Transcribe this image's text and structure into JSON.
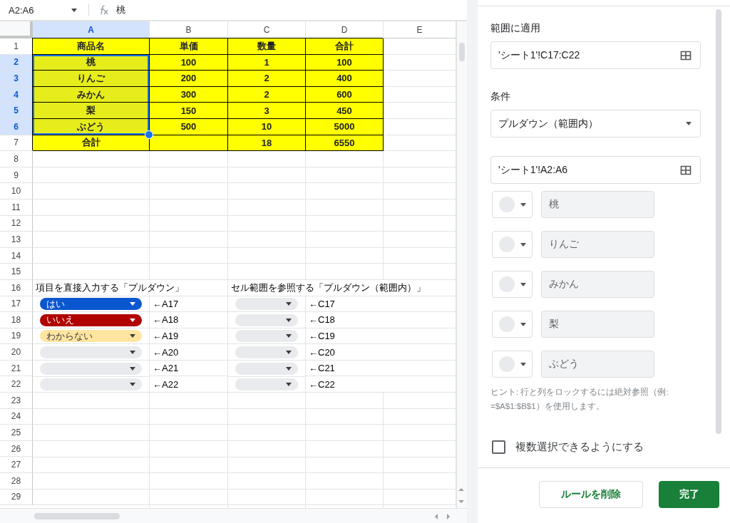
{
  "formula_bar": {
    "name_box": "A2:A6",
    "formula": "桃"
  },
  "sheet": {
    "columns": [
      {
        "label": "A",
        "selected": true
      },
      {
        "label": "B",
        "selected": false
      },
      {
        "label": "C",
        "selected": false
      },
      {
        "label": "D",
        "selected": false
      },
      {
        "label": "E",
        "selected": false
      }
    ],
    "rows": [
      {
        "number": "1",
        "selected": false,
        "cells": [
          {
            "kind": "filled",
            "text": "商品名"
          },
          {
            "kind": "filled",
            "text": "単価"
          },
          {
            "kind": "filled",
            "text": "数量"
          },
          {
            "kind": "filled",
            "text": "合計"
          }
        ]
      },
      {
        "number": "2",
        "selected": true,
        "cells": [
          {
            "kind": "filled",
            "text": "桃"
          },
          {
            "kind": "filled",
            "text": "100"
          },
          {
            "kind": "filled",
            "text": "1"
          },
          {
            "kind": "filled",
            "text": "100"
          }
        ]
      },
      {
        "number": "3",
        "selected": true,
        "cells": [
          {
            "kind": "filled",
            "text": "りんご"
          },
          {
            "kind": "filled",
            "text": "200"
          },
          {
            "kind": "filled",
            "text": "2"
          },
          {
            "kind": "filled",
            "text": "400"
          }
        ]
      },
      {
        "number": "4",
        "selected": true,
        "cells": [
          {
            "kind": "filled",
            "text": "みかん"
          },
          {
            "kind": "filled",
            "text": "300"
          },
          {
            "kind": "filled",
            "text": "2"
          },
          {
            "kind": "filled",
            "text": "600"
          }
        ]
      },
      {
        "number": "5",
        "selected": true,
        "cells": [
          {
            "kind": "filled",
            "text": "梨"
          },
          {
            "kind": "filled",
            "text": "150"
          },
          {
            "kind": "filled",
            "text": "3"
          },
          {
            "kind": "filled",
            "text": "450"
          }
        ]
      },
      {
        "number": "6",
        "selected": true,
        "cells": [
          {
            "kind": "filled",
            "text": "ぶどう"
          },
          {
            "kind": "filled",
            "text": "500"
          },
          {
            "kind": "filled",
            "text": "10"
          },
          {
            "kind": "filled",
            "text": "5000"
          }
        ]
      },
      {
        "number": "7",
        "selected": false,
        "cells": [
          {
            "kind": "filled",
            "text": "合計"
          },
          {
            "kind": "filled"
          },
          {
            "kind": "filled",
            "text": "18"
          },
          {
            "kind": "filled",
            "text": "6550"
          }
        ]
      },
      {
        "number": "8",
        "selected": false,
        "cells": []
      },
      {
        "number": "9",
        "selected": false,
        "cells": []
      },
      {
        "number": "10",
        "selected": false,
        "cells": []
      },
      {
        "number": "11",
        "selected": false,
        "cells": []
      },
      {
        "number": "12",
        "selected": false,
        "cells": []
      },
      {
        "number": "13",
        "selected": false,
        "cells": []
      },
      {
        "number": "14",
        "selected": false,
        "cells": []
      },
      {
        "number": "15",
        "selected": false,
        "cells": []
      },
      {
        "number": "16",
        "selected": false,
        "cells": [
          {
            "kind": "text",
            "text": "項目を直接入力する「プルダウン」"
          },
          {
            "kind": "blank"
          },
          {
            "kind": "text",
            "text": "セル範囲を参照する「プルダウン（範囲内）」"
          }
        ]
      },
      {
        "number": "17",
        "selected": false,
        "cells": [
          {
            "kind": "chip",
            "text": "はい",
            "color": "#0b57d0"
          },
          {
            "kind": "text",
            "text": "←A17"
          },
          {
            "kind": "chip",
            "color": "#e8eaed"
          },
          {
            "kind": "text",
            "text": "←C17"
          }
        ]
      },
      {
        "number": "18",
        "selected": false,
        "cells": [
          {
            "kind": "chip",
            "text": "いいえ",
            "color": "#b10202"
          },
          {
            "kind": "text",
            "text": "←A18"
          },
          {
            "kind": "chip",
            "color": "#e8eaed"
          },
          {
            "kind": "text",
            "text": "←C18"
          }
        ]
      },
      {
        "number": "19",
        "selected": false,
        "cells": [
          {
            "kind": "chip",
            "text": "わからない",
            "color": "#ffe5a0"
          },
          {
            "kind": "text",
            "text": "←A19"
          },
          {
            "kind": "chip",
            "color": "#e8eaed"
          },
          {
            "kind": "text",
            "text": "←C19"
          }
        ]
      },
      {
        "number": "20",
        "selected": false,
        "cells": [
          {
            "kind": "chip",
            "color": "#e8eaed"
          },
          {
            "kind": "text",
            "text": "←A20"
          },
          {
            "kind": "chip",
            "color": "#e8eaed"
          },
          {
            "kind": "text",
            "text": "←C20"
          }
        ]
      },
      {
        "number": "21",
        "selected": false,
        "cells": [
          {
            "kind": "chip",
            "color": "#e8eaed"
          },
          {
            "kind": "text",
            "text": "←A21"
          },
          {
            "kind": "chip",
            "color": "#e8eaed"
          },
          {
            "kind": "text",
            "text": "←C21"
          }
        ]
      },
      {
        "number": "22",
        "selected": false,
        "cells": [
          {
            "kind": "chip",
            "color": "#e8eaed"
          },
          {
            "kind": "text",
            "text": "←A22"
          },
          {
            "kind": "chip",
            "color": "#e8eaed"
          },
          {
            "kind": "text",
            "text": "←C22"
          }
        ]
      },
      {
        "number": "23",
        "selected": false,
        "cells": []
      },
      {
        "number": "24",
        "selected": false,
        "cells": []
      },
      {
        "number": "25",
        "selected": false,
        "cells": []
      },
      {
        "number": "26",
        "selected": false,
        "cells": []
      },
      {
        "number": "27",
        "selected": false,
        "cells": []
      },
      {
        "number": "28",
        "selected": false,
        "cells": []
      },
      {
        "number": "29",
        "selected": false,
        "cells": []
      }
    ]
  },
  "panel": {
    "apply_range": {
      "label": "範囲に適用",
      "value": "'シート1'!C17:C22"
    },
    "condition": {
      "label": "条件",
      "value": "プルダウン（範囲内）"
    },
    "source_range": {
      "value": "'シート1'!A2:A6"
    },
    "options": [
      {
        "value": "桃"
      },
      {
        "value": "りんご"
      },
      {
        "value": "みかん"
      },
      {
        "value": "梨"
      },
      {
        "value": "ぶどう"
      }
    ],
    "hint": "ヒント: 行と列をロックするには絶対参照（例: =$A$1:$B$1）を使用します。",
    "multi_select": {
      "label": "複数選択できるようにする",
      "checked": false
    },
    "buttons": [
      {
        "label": "ルールを削除",
        "kind": "secondary"
      },
      {
        "label": "完了",
        "kind": "primary"
      }
    ]
  }
}
